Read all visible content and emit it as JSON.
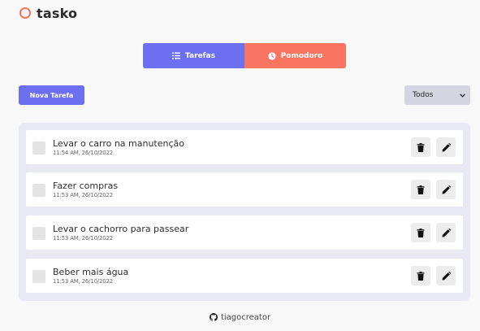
{
  "app": {
    "name": "tasko",
    "accent": "#6c6ff0",
    "secondary": "#fa7462"
  },
  "tabs": [
    {
      "label": "Tarefas",
      "icon": "list-check-icon",
      "active": true
    },
    {
      "label": "Pomodoro",
      "icon": "clock-icon",
      "active": false
    }
  ],
  "toolbar": {
    "new_task_label": "Nova Tarefa",
    "filter_value": "Todos"
  },
  "tasks": [
    {
      "title": "Levar o carro na manutenção",
      "date": "11:54 AM, 26/10/2022",
      "done": false
    },
    {
      "title": "Fazer compras",
      "date": "11:53 AM, 26/10/2022",
      "done": false
    },
    {
      "title": "Levar o cachorro para passear",
      "date": "11:53 AM, 26/10/2022",
      "done": false
    },
    {
      "title": "Beber mais água",
      "date": "11:53 AM, 26/10/2022",
      "done": false
    }
  ],
  "footer": {
    "author": "tiagocreator",
    "icon": "github-icon"
  }
}
